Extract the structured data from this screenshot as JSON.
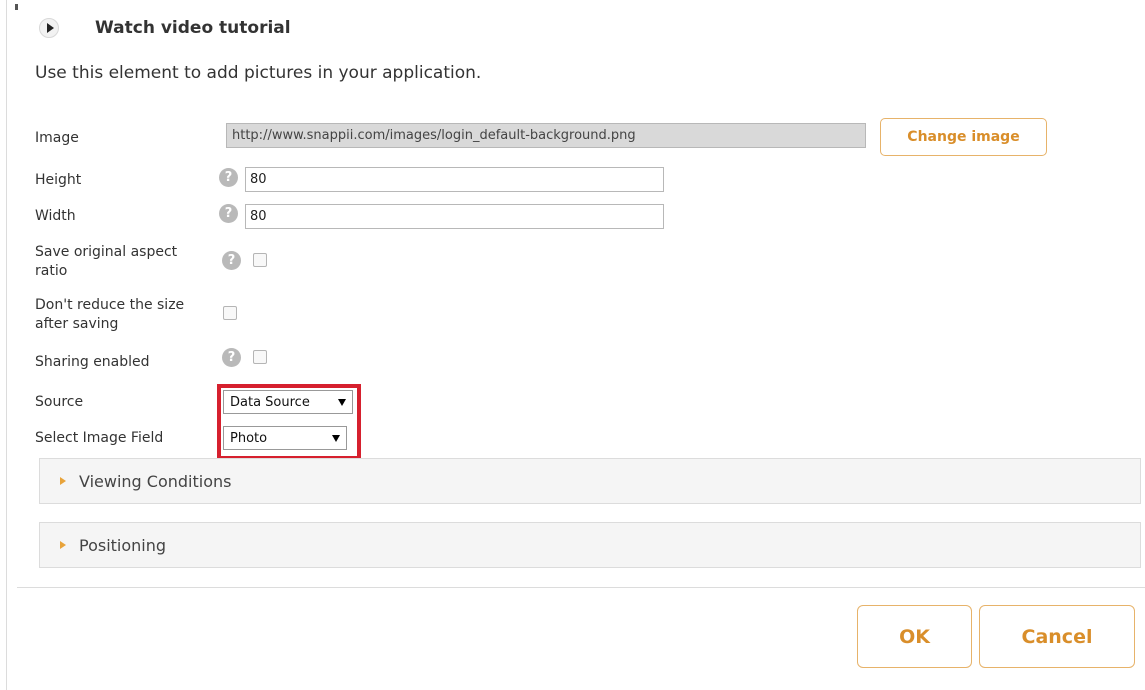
{
  "header": {
    "tutorial_label": "Watch video tutorial",
    "intro": "Use this element to add pictures in your application."
  },
  "form": {
    "image": {
      "label": "Image",
      "url": "http://www.snappii.com/images/login_default-background.png",
      "change_label": "Change image"
    },
    "height": {
      "label": "Height",
      "value": "80"
    },
    "width": {
      "label": "Width",
      "value": "80"
    },
    "aspect": {
      "label_line1": "Save original aspect",
      "label_line2": "ratio",
      "checked": false
    },
    "reduce": {
      "label_line1": "Don't reduce the size",
      "label_line2": "after saving",
      "checked": false
    },
    "sharing": {
      "label": "Sharing enabled",
      "checked": false
    },
    "source": {
      "label": "Source",
      "value": "Data Source"
    },
    "image_field": {
      "label": "Select Image Field",
      "value": "Photo"
    },
    "help_glyph": "?"
  },
  "sections": [
    {
      "label": "Viewing Conditions",
      "expanded": false
    },
    {
      "label": "Positioning",
      "expanded": false
    }
  ],
  "footer": {
    "ok_label": "OK",
    "cancel_label": "Cancel"
  },
  "colors": {
    "accent": "#d98e2a",
    "accent_border": "#e7b36a",
    "highlight": "#d6202e"
  },
  "icons": {
    "tutorial": "play-icon",
    "help": "question-icon",
    "section": "caret-right-icon",
    "dropdown": "caret-down-icon"
  }
}
